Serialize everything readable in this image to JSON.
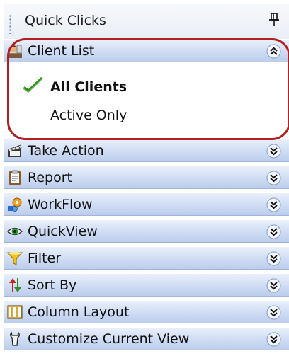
{
  "panel": {
    "title": "Quick Clicks",
    "pin_icon": "pin-icon"
  },
  "client_list": {
    "label": "Client List",
    "icon": "client-list-icon",
    "chevron": "collapse-chevron-icon",
    "expanded": true,
    "items": [
      {
        "label": "All Clients",
        "selected": true
      },
      {
        "label": "Active Only",
        "selected": false
      }
    ]
  },
  "sections": [
    {
      "label": "Take Action",
      "icon": "clapperboard-icon"
    },
    {
      "label": "Report",
      "icon": "report-icon"
    },
    {
      "label": "WorkFlow",
      "icon": "workflow-icon"
    },
    {
      "label": "QuickView",
      "icon": "eye-icon"
    },
    {
      "label": "Filter",
      "icon": "funnel-icon"
    },
    {
      "label": "Sort By",
      "icon": "sort-arrows-icon"
    },
    {
      "label": "Column Layout",
      "icon": "columns-icon"
    },
    {
      "label": "Customize Current View",
      "icon": "wrench-icon"
    }
  ],
  "colors": {
    "section_gradient_top": "#eaf0fb",
    "section_gradient_bottom": "#bccdec",
    "highlight_ring": "#b22022",
    "check_green": "#2f8f1f"
  }
}
